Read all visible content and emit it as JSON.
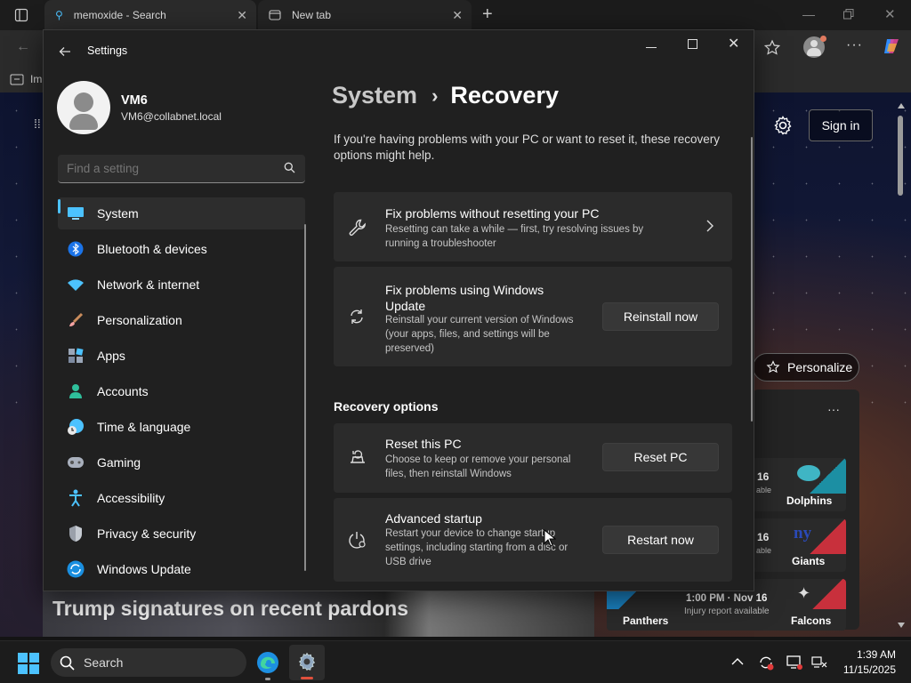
{
  "browser": {
    "tabs": [
      {
        "title": "memoxide - Search",
        "icon": "search-icon"
      },
      {
        "title": "New tab",
        "icon": "newtab-icon"
      }
    ],
    "favorites_partial": "Im"
  },
  "msn": {
    "sign_in": "Sign in",
    "personalize": "Personalize",
    "headline": "Trump signatures on recent pardons",
    "more": "···",
    "games": [
      {
        "partial_score": "16",
        "partial_status": "able",
        "team": "Dolphins"
      },
      {
        "partial_score": "16",
        "partial_status": "able",
        "team": "Giants"
      },
      {
        "left_team": "Panthers",
        "time": "1:00 PM · Nov 16",
        "status": "Injury report available",
        "team": "Falcons"
      }
    ]
  },
  "settings": {
    "app_title": "Settings",
    "user": {
      "name": "VM6",
      "email": "VM6@collabnet.local"
    },
    "search_placeholder": "Find a setting",
    "nav": [
      {
        "label": "System",
        "icon": "system-icon",
        "selected": true
      },
      {
        "label": "Bluetooth & devices",
        "icon": "bluetooth-icon"
      },
      {
        "label": "Network & internet",
        "icon": "wifi-icon"
      },
      {
        "label": "Personalization",
        "icon": "brush-icon"
      },
      {
        "label": "Apps",
        "icon": "apps-icon"
      },
      {
        "label": "Accounts",
        "icon": "person-icon"
      },
      {
        "label": "Time & language",
        "icon": "clock-globe-icon"
      },
      {
        "label": "Gaming",
        "icon": "gamepad-icon"
      },
      {
        "label": "Accessibility",
        "icon": "accessibility-icon"
      },
      {
        "label": "Privacy & security",
        "icon": "shield-icon"
      },
      {
        "label": "Windows Update",
        "icon": "update-icon"
      }
    ],
    "breadcrumb": {
      "parent": "System",
      "separator": "›",
      "current": "Recovery"
    },
    "intro": "If you're having problems with your PC or want to reset it, these recovery options might help.",
    "cards": {
      "troubleshoot": {
        "title": "Fix problems without resetting your PC",
        "desc": "Resetting can take a while — first, try resolving issues by running a troubleshooter"
      },
      "windows_update": {
        "title": "Fix problems using Windows Update",
        "desc": "Reinstall your current version of Windows (your apps, files, and settings will be preserved)",
        "button": "Reinstall now"
      }
    },
    "recovery_options_header": "Recovery options",
    "options": {
      "reset": {
        "title": "Reset this PC",
        "desc": "Choose to keep or remove your personal files, then reinstall Windows",
        "button": "Reset PC"
      },
      "advanced": {
        "title": "Advanced startup",
        "desc": "Restart your device to change startup settings, including starting from a disc or USB drive",
        "button": "Restart now"
      }
    }
  },
  "taskbar": {
    "search_label": "Search",
    "time": "1:39 AM",
    "date": "11/15/2025"
  },
  "colors": {
    "accent": "#4cc2ff",
    "window_bg": "#202020",
    "card_bg": "#2b2b2b",
    "taskbar_bg": "#1c1c1c"
  }
}
